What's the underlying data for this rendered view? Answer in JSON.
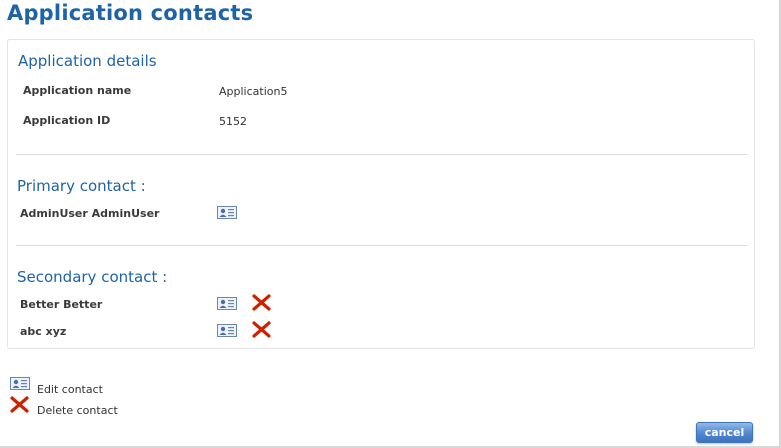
{
  "page": {
    "title": "Application contacts"
  },
  "application_details": {
    "heading": "Application details",
    "fields": [
      {
        "label": "Application name",
        "value": "Application5"
      },
      {
        "label": "Application ID",
        "value": "5152"
      }
    ]
  },
  "primary_contact": {
    "heading": "Primary contact :",
    "contacts": [
      {
        "name": "AdminUser AdminUser"
      }
    ]
  },
  "secondary_contact": {
    "heading": "Secondary contact :",
    "contacts": [
      {
        "name": "Better Better"
      },
      {
        "name": "abc xyz"
      }
    ]
  },
  "legend": {
    "edit_label": "Edit contact",
    "delete_label": "Delete contact"
  },
  "actions": {
    "cancel_label": "cancel"
  },
  "icons": {
    "edit": "contact-card-icon",
    "delete": "red-x-icon"
  },
  "colors": {
    "heading": "#1e63a8",
    "delete": "#cc2200",
    "button": "#4f86cf"
  }
}
